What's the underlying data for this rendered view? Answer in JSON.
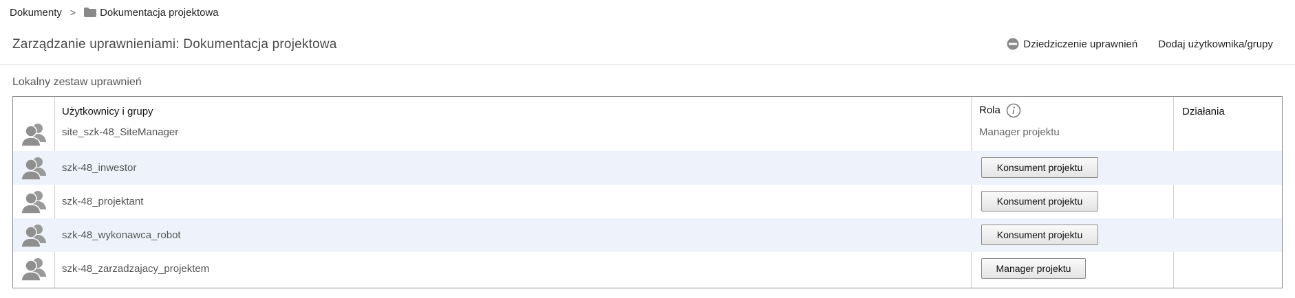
{
  "breadcrumb": {
    "root": "Dokumenty",
    "separator": ">",
    "current": "Dokumentacja projektowa",
    "current_icon": "folder-icon"
  },
  "header": {
    "title": "Zarządzanie uprawnieniami: Dokumentacja projektowa",
    "actions": {
      "inherit_label": "Dziedziczenie uprawnień",
      "inherit_icon": "no-entry-icon",
      "add_label": "Dodaj użytkownika/grupy"
    }
  },
  "section": {
    "title": "Lokalny zestaw uprawnień"
  },
  "table": {
    "columns": {
      "users": "Użytkownicy i grupy",
      "role": "Rola",
      "actions": "Działania"
    },
    "rows": [
      {
        "name": "site_szk-48_SiteManager",
        "role": "Manager projektu",
        "editable": false,
        "avatar_icon": "group-icon"
      },
      {
        "name": "szk-48_inwestor",
        "role": "Konsument projektu",
        "editable": true,
        "avatar_icon": "group-icon"
      },
      {
        "name": "szk-48_projektant",
        "role": "Konsument projektu",
        "editable": true,
        "avatar_icon": "group-icon"
      },
      {
        "name": "szk-48_wykonawca_robot",
        "role": "Konsument projektu",
        "editable": true,
        "avatar_icon": "group-icon"
      },
      {
        "name": "szk-48_zarzadzajacy_projektem",
        "role": "Manager projektu",
        "editable": true,
        "avatar_icon": "group-icon"
      }
    ]
  },
  "colors": {
    "alt_row": "#eef3fb",
    "border": "#8c8c8c",
    "title": "#4a4a4a"
  }
}
